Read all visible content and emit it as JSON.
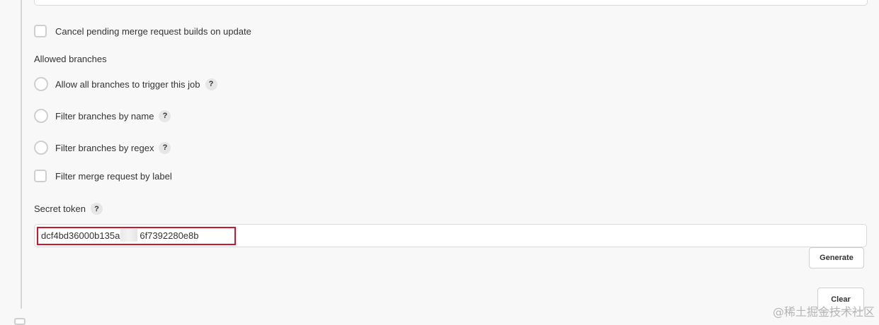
{
  "cancel_pending": {
    "label": "Cancel pending merge request builds on update",
    "checked": false
  },
  "allowed_branches": {
    "heading": "Allowed branches",
    "options": [
      {
        "label": "Allow all branches to trigger this job",
        "help": "?"
      },
      {
        "label": "Filter branches by name",
        "help": "?"
      },
      {
        "label": "Filter branches by regex",
        "help": "?"
      }
    ],
    "filter_label": {
      "label": "Filter merge request by label",
      "checked": false
    }
  },
  "secret_token": {
    "label": "Secret token",
    "help": "?",
    "value_start": "dcf4bd36000b135a",
    "value_end": "6f7392280e8b",
    "highlight_color": "#c9182b"
  },
  "buttons": {
    "generate": "Generate",
    "clear": "Clear"
  },
  "watermark": "@稀土掘金技术社区"
}
